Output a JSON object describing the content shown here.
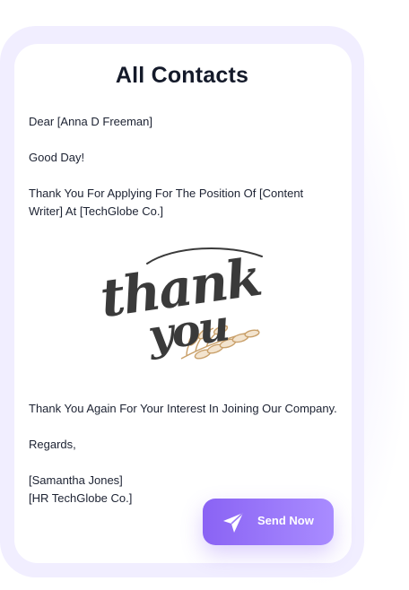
{
  "card": {
    "title": "All Contacts"
  },
  "letter": {
    "greeting": "Dear [Anna D Freeman]",
    "opening": "Good Day!",
    "line1": "Thank You For Applying For The Position Of [Content",
    "line2": "Writer] At [TechGlobe Co.]",
    "closing_line": "Thank You Again For Your Interest In Joining Our Company.",
    "signoff": "Regards,",
    "signer_name": "[Samantha Jones]",
    "signer_company": "[HR TechGlobe Co.]"
  },
  "image": {
    "lettering_line1": "thank",
    "lettering_line2": "you"
  },
  "actions": {
    "send_label": "Send Now",
    "send_icon": "paper-plane-icon"
  },
  "colors": {
    "frame": "#f1eeff",
    "card": "#ffffff",
    "title": "#141a2a",
    "button_start": "#8a63f4",
    "button_end": "#a98cff",
    "leaf": "#c9a06a"
  }
}
